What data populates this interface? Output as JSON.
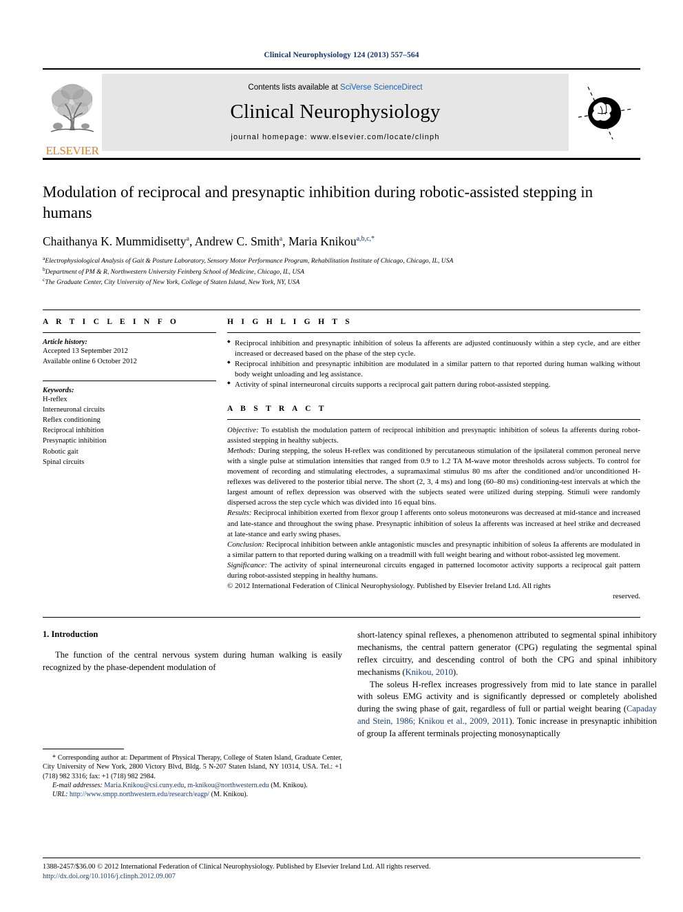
{
  "running_head": "Clinical Neurophysiology 124 (2013) 557–564",
  "masthead": {
    "contents_prefix": "Contents lists available at ",
    "contents_link": "SciVerse ScienceDirect",
    "journal_title": "Clinical Neurophysiology",
    "homepage": "journal homepage: www.elsevier.com/locate/clinph",
    "publisher_wordmark": "ELSEVIER",
    "publisher_color": "#ef7d1a",
    "link_color": "#1a5fb4"
  },
  "article": {
    "title": "Modulation of reciprocal and presynaptic inhibition during robotic-assisted stepping in humans",
    "authors": [
      {
        "name": "Chaithanya K. Mummidisetty",
        "sup": "a"
      },
      {
        "name": "Andrew C. Smith",
        "sup": "a"
      },
      {
        "name": "Maria Knikou",
        "sup": "a,b,c,*"
      }
    ],
    "affiliations": [
      {
        "mark": "a",
        "text": "Electrophysiological Analysis of Gait & Posture Laboratory, Sensory Motor Performance Program, Rehabilitation Institute of Chicago, Chicago, IL, USA"
      },
      {
        "mark": "b",
        "text": "Department of PM & R, Northwestern University Feinberg School of Medicine, Chicago, IL, USA"
      },
      {
        "mark": "c",
        "text": "The Graduate Center, City University of New York, College of Staten Island, New York, NY, USA"
      }
    ]
  },
  "article_info": {
    "heading": "A R T I C L E   I N F O",
    "history_label": "Article history:",
    "history": [
      "Accepted 13 September 2012",
      "Available online 6 October 2012"
    ],
    "keywords_label": "Keywords:",
    "keywords": [
      "H-reflex",
      "Interneuronal circuits",
      "Reflex conditioning",
      "Reciprocal inhibition",
      "Presynaptic inhibition",
      "Robotic gait",
      "Spinal circuits"
    ]
  },
  "highlights": {
    "heading": "H I G H L I G H T S",
    "items": [
      "Reciprocal inhibition and presynaptic inhibition of soleus Ia afferents are adjusted continuously within a step cycle, and are either increased or decreased based on the phase of the step cycle.",
      "Reciprocal inhibition and presynaptic inhibition are modulated in a similar pattern to that reported during human walking without body weight unloading and leg assistance.",
      "Activity of spinal interneuronal circuits supports a reciprocal gait pattern during robot-assisted stepping."
    ]
  },
  "abstract": {
    "heading": "A B S T R A C T",
    "sections": [
      {
        "label": "Objective:",
        "text": " To establish the modulation pattern of reciprocal inhibition and presynaptic inhibition of soleus Ia afferents during robot-assisted stepping in healthy subjects."
      },
      {
        "label": "Methods:",
        "text": " During stepping, the soleus H-reflex was conditioned by percutaneous stimulation of the ipsilateral common peroneal nerve with a single pulse at stimulation intensities that ranged from 0.9 to 1.2 TA M-wave motor thresholds across subjects. To control for movement of recording and stimulating electrodes, a supramaximal stimulus 80 ms after the conditioned and/or unconditioned H-reflexes was delivered to the posterior tibial nerve. The short (2, 3, 4 ms) and long (60–80 ms) conditioning-test intervals at which the largest amount of reflex depression was observed with the subjects seated were utilized during stepping. Stimuli were randomly dispersed across the step cycle which was divided into 16 equal bins."
      },
      {
        "label": "Results:",
        "text": " Reciprocal inhibition exerted from flexor group I afferents onto soleus motoneurons was decreased at mid-stance and increased and late-stance and throughout the swing phase. Presynaptic inhibition of soleus Ia afferents was increased at heel strike and decreased at late-stance and early swing phases."
      },
      {
        "label": "Conclusion:",
        "text": " Reciprocal inhibition between ankle antagonistic muscles and presynaptic inhibition of soleus Ia afferents are modulated in a similar pattern to that reported during walking on a treadmill with full weight bearing and without robot-assisted leg movement."
      },
      {
        "label": "Significance:",
        "text": " The activity of spinal interneuronal circuits engaged in patterned locomotor activity supports a reciprocal gait pattern during robot-assisted stepping in healthy humans."
      }
    ],
    "copyright": "© 2012 International Federation of Clinical Neurophysiology. Published by Elsevier Ireland Ltd. All rights",
    "copyright_tail": "reserved."
  },
  "body": {
    "intro_heading": "1. Introduction",
    "left_paragraph": "The function of the central nervous system during human walking is easily recognized by the phase-dependent modulation of",
    "right_paragraph_1_a": "short-latency spinal reflexes, a phenomenon attributed to segmental spinal inhibitory mechanisms, the central pattern generator (CPG) regulating the segmental spinal reflex circuitry, and descending control of both the CPG and spinal inhibitory mechanisms (",
    "right_paragraph_1_cite": "Knikou, 2010",
    "right_paragraph_1_b": ").",
    "right_paragraph_2_a": "The soleus H-reflex increases progressively from mid to late stance in parallel with soleus EMG activity and is significantly depressed or completely abolished during the swing phase of gait, regardless of full or partial weight bearing (",
    "right_paragraph_2_cite": "Capaday and Stein, 1986; Knikou et al., 2009, 2011",
    "right_paragraph_2_b": "). Tonic increase in presynaptic inhibition of group Ia afferent terminals projecting monosynaptically"
  },
  "footnotes": {
    "corresponding": "* Corresponding author at: Department of Physical Therapy, College of Staten Island, Graduate Center, City University of New York, 2800 Victory Blvd, Bldg. 5 N-207 Staten Island, NY 10314, USA. Tel.: +1 (718) 982 3316; fax: +1 (718) 982 2984.",
    "email_label": "E-mail addresses:",
    "email_1": "Maria.Knikou@csi.cuny.edu",
    "email_sep": ", ",
    "email_2": "m-knikou@northwestern.edu",
    "email_owner": " (M. Knikou).",
    "url_label": "URL:",
    "url_value": "http://www.smpp.northwestern.edu/research/eagp/",
    "url_owner": " (M. Knikou)."
  },
  "page_footer": {
    "issn_line": "1388-2457/$36.00 © 2012 International Federation of Clinical Neurophysiology. Published by Elsevier Ireland Ltd. All rights reserved.",
    "doi_line": "http://dx.doi.org/10.1016/j.clinph.2012.09.007"
  }
}
